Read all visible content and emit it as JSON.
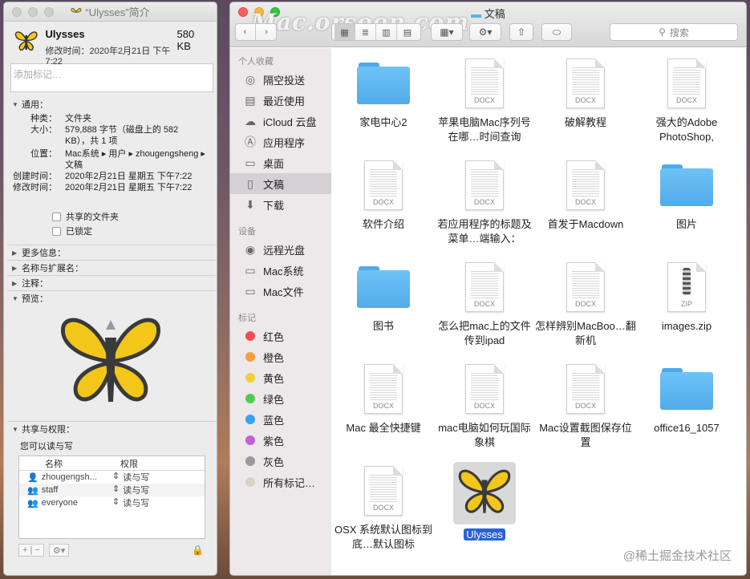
{
  "info": {
    "title": "“Ulysses”简介",
    "app_name": "Ulysses",
    "size": "580 KB",
    "modified": "修改时间：2020年2月21日 下午7:22",
    "tags_placeholder": "添加标记…",
    "general_header": "通用：",
    "rows": [
      {
        "k": "种类：",
        "v": "文件夹"
      },
      {
        "k": "大小：",
        "v": "579,888 字节（磁盘上的 582 KB），共 1 项"
      },
      {
        "k": "位置：",
        "v": "Mac系统 ▸ 用户 ▸ zhougengsheng ▸ 文稿"
      },
      {
        "k": "创建时间：",
        "v": "2020年2月21日 星期五 下午7:22"
      },
      {
        "k": "修改时间：",
        "v": "2020年2月21日 星期五 下午7:22"
      }
    ],
    "shared_folder": "共享的文件夹",
    "locked": "已锁定",
    "more_info": "更多信息：",
    "name_ext": "名称与扩展名：",
    "comments": "注释：",
    "preview": "预览：",
    "sharing_header": "共享与权限：",
    "sharing_note": "您可以读与写",
    "perm_col_name": "名称",
    "perm_col_priv": "权限",
    "perm_rows": [
      {
        "name": "zhougengsh...",
        "priv": "读与写"
      },
      {
        "name": "staff",
        "priv": "读与写"
      },
      {
        "name": "everyone",
        "priv": "读与写"
      }
    ]
  },
  "finder": {
    "title": "文稿",
    "watermark": "Mac.orsoon.com",
    "search_placeholder": "搜索",
    "sidebar": {
      "favorites_header": "个人收藏",
      "favorites": [
        {
          "label": "隔空投送",
          "icon": "airdrop-icon"
        },
        {
          "label": "最近使用",
          "icon": "recents-icon"
        },
        {
          "label": "iCloud 云盘",
          "icon": "icloud-icon"
        },
        {
          "label": "应用程序",
          "icon": "applications-icon"
        },
        {
          "label": "桌面",
          "icon": "desktop-icon"
        },
        {
          "label": "文稿",
          "icon": "documents-icon",
          "selected": true
        },
        {
          "label": "下载",
          "icon": "downloads-icon"
        }
      ],
      "devices_header": "设备",
      "devices": [
        {
          "label": "远程光盘",
          "icon": "disc-icon"
        },
        {
          "label": "Mac系统",
          "icon": "disk-icon"
        },
        {
          "label": "Mac文件",
          "icon": "disk-icon"
        }
      ],
      "tags_header": "标记",
      "tags": [
        {
          "label": "红色",
          "color": "#f24e4e"
        },
        {
          "label": "橙色",
          "color": "#f5a03c"
        },
        {
          "label": "黄色",
          "color": "#f2cf3a"
        },
        {
          "label": "绿色",
          "color": "#4fcb53"
        },
        {
          "label": "蓝色",
          "color": "#36a3ef"
        },
        {
          "label": "紫色",
          "color": "#c260d8"
        },
        {
          "label": "灰色",
          "color": "#9a9a9a"
        },
        {
          "label": "所有标记…",
          "color": "#d8d3c4"
        }
      ]
    },
    "files": [
      {
        "name": "家电中心2",
        "kind": "folder"
      },
      {
        "name": "苹果电脑Mac序列号在哪…时间查询",
        "kind": "docx"
      },
      {
        "name": "破解教程",
        "kind": "docx"
      },
      {
        "name": "强大的Adobe PhotoShop,",
        "kind": "docx"
      },
      {
        "name": "软件介绍",
        "kind": "docx"
      },
      {
        "name": "若应用程序的标题及菜单…端输入：",
        "kind": "docx"
      },
      {
        "name": "首发于Macdown",
        "kind": "docx"
      },
      {
        "name": "图片",
        "kind": "folder"
      },
      {
        "name": "图书",
        "kind": "folder"
      },
      {
        "name": "怎么把mac上的文件传到ipad",
        "kind": "docx"
      },
      {
        "name": "怎样辨别MacBoo…翻新机",
        "kind": "docx"
      },
      {
        "name": "images.zip",
        "kind": "zip"
      },
      {
        "name": "Mac 最全快捷键",
        "kind": "docx"
      },
      {
        "name": "mac电脑如何玩国际象棋",
        "kind": "docx"
      },
      {
        "name": "Mac设置截图保存位置",
        "kind": "docx"
      },
      {
        "name": "office16_1057",
        "kind": "folder"
      },
      {
        "name": "OSX 系统默认图标到底…默认图标",
        "kind": "docx"
      },
      {
        "name": "Ulysses",
        "kind": "app",
        "selected": true
      }
    ],
    "docx_tag": "DOCX",
    "zip_tag": "ZIP"
  },
  "credit": "@稀土掘金技术社区"
}
